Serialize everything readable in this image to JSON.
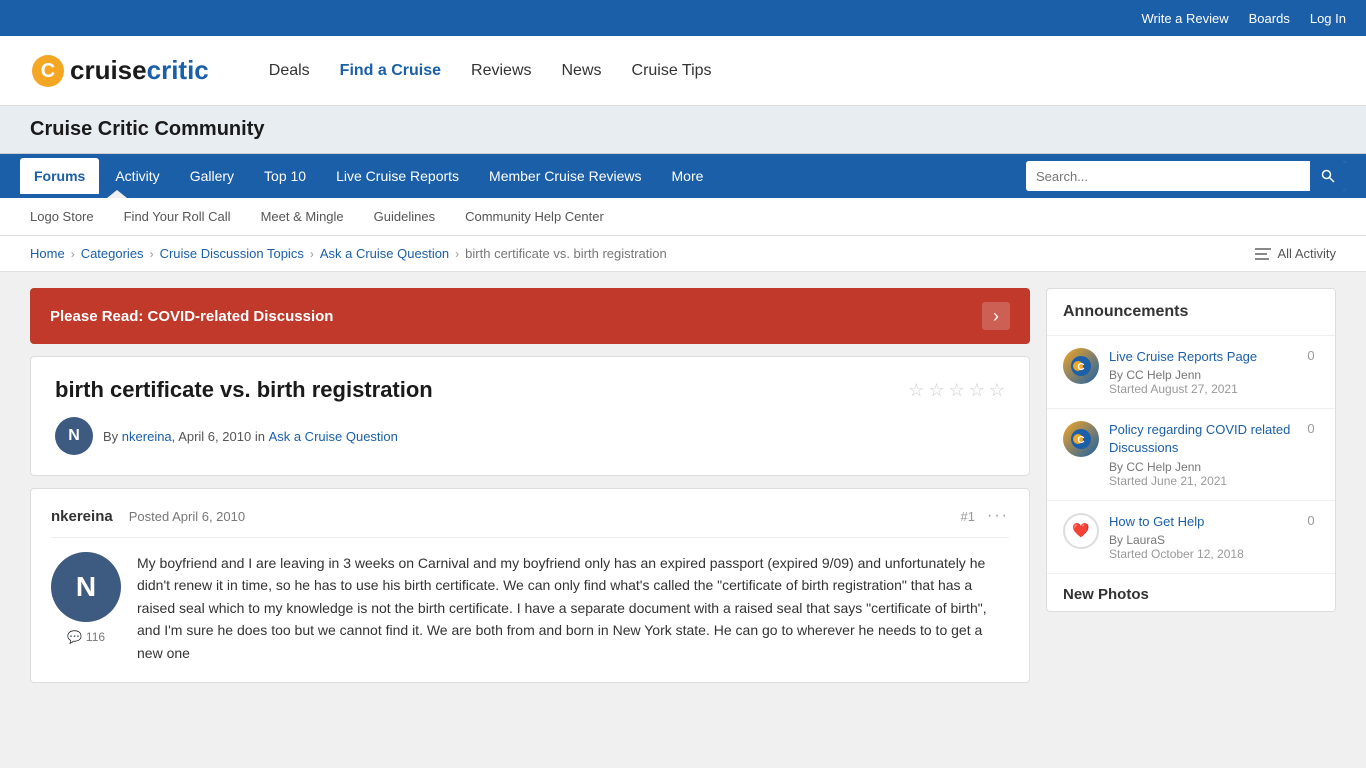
{
  "topbar": {
    "write_review": "Write a Review",
    "boards": "Boards",
    "log_in": "Log In"
  },
  "header": {
    "logo_cruise": "cruise",
    "logo_critic": "critic",
    "nav": [
      {
        "label": "Deals",
        "href": "#"
      },
      {
        "label": "Find a Cruise",
        "href": "#"
      },
      {
        "label": "Reviews",
        "href": "#"
      },
      {
        "label": "News",
        "href": "#"
      },
      {
        "label": "Cruise Tips",
        "href": "#"
      }
    ]
  },
  "community": {
    "title": "Cruise Critic Community"
  },
  "forums_nav": {
    "items": [
      {
        "label": "Forums",
        "active": true
      },
      {
        "label": "Activity"
      },
      {
        "label": "Gallery"
      },
      {
        "label": "Top 10"
      },
      {
        "label": "Live Cruise Reports"
      },
      {
        "label": "Member Cruise Reviews"
      },
      {
        "label": "More"
      }
    ],
    "search_placeholder": "Search..."
  },
  "sub_nav": {
    "items": [
      {
        "label": "Logo Store"
      },
      {
        "label": "Find Your Roll Call"
      },
      {
        "label": "Meet & Mingle"
      },
      {
        "label": "Guidelines"
      },
      {
        "label": "Community Help Center"
      }
    ]
  },
  "breadcrumb": {
    "items": [
      {
        "label": "Home",
        "href": "#"
      },
      {
        "label": "Categories",
        "href": "#"
      },
      {
        "label": "Cruise Discussion Topics",
        "href": "#"
      },
      {
        "label": "Ask a Cruise Question",
        "href": "#"
      }
    ],
    "current": "birth certificate vs. birth registration",
    "all_activity": "All Activity"
  },
  "covid_banner": {
    "text": "Please Read: COVID-related Discussion"
  },
  "thread": {
    "title": "birth certificate vs. birth registration",
    "stars": [
      "★",
      "★",
      "★",
      "★",
      "★"
    ],
    "by_label": "By",
    "author": "nkereina,",
    "date": "April 6, 2010",
    "in_label": "in",
    "category": "Ask a Cruise Question",
    "avatar_letter": "N"
  },
  "post": {
    "username": "nkereina",
    "posted_label": "Posted",
    "date": "April 6, 2010",
    "number": "#1",
    "avatar_letter": "N",
    "reply_count": "116",
    "reply_icon": "💬",
    "content": "My boyfriend and I are leaving in 3 weeks on Carnival and my boyfriend only has an expired passport (expired 9/09) and unfortunately he didn't renew it in time, so he has to use his birth certificate. We can only find what's called the \"certificate of birth registration\" that has a raised seal which to my knowledge is not the birth certificate. I have a separate document with a raised seal that says \"certificate of birth\", and I'm sure he does too but we cannot find it. We are both from and born in New York state. He can go to wherever he needs to to get a new one"
  },
  "sidebar": {
    "announcements_title": "Announcements",
    "announcements": [
      {
        "title": "Live Cruise Reports Page",
        "by": "By CC Help Jenn",
        "started": "Started August 27, 2021",
        "count": "0",
        "icon_type": "cc"
      },
      {
        "title": "Policy regarding COVID related Discussions",
        "by": "By CC Help Jenn",
        "started": "Started June 21, 2021",
        "count": "0",
        "icon_type": "cc"
      },
      {
        "title": "How to Get Help",
        "by": "By LauraS",
        "started": "Started October 12, 2018",
        "count": "0",
        "icon_type": "heart"
      }
    ],
    "new_photos_title": "New Photos"
  }
}
